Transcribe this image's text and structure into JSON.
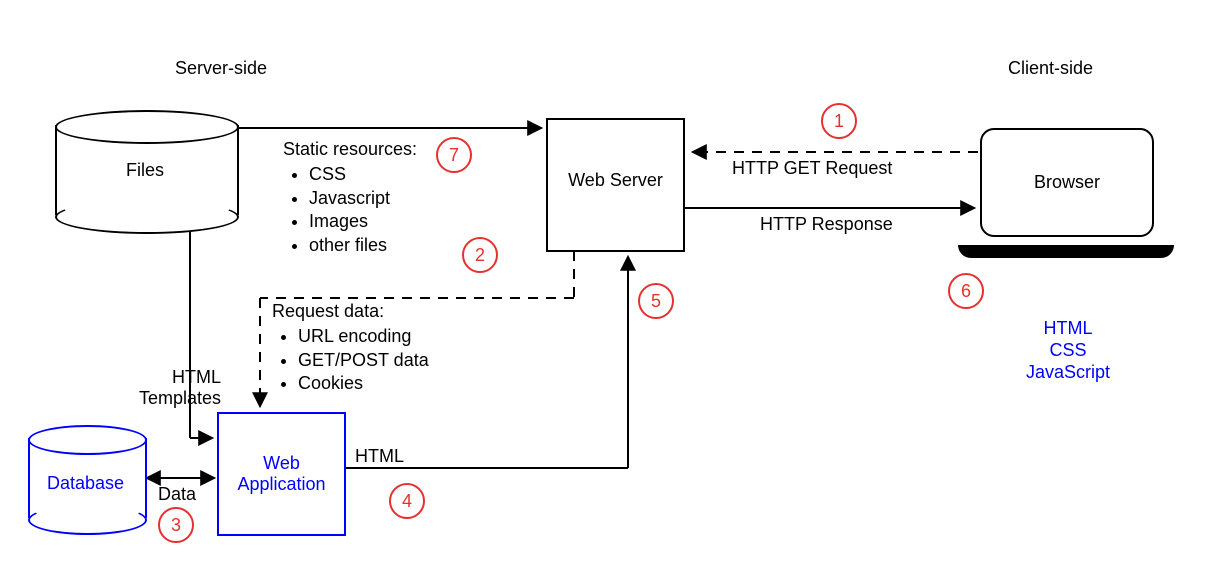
{
  "headers": {
    "server_side": "Server-side",
    "client_side": "Client-side"
  },
  "files": {
    "label": "Files"
  },
  "database": {
    "label": "Database"
  },
  "web_server": {
    "label": "Web Server"
  },
  "web_app": {
    "label": "Web\nApplication"
  },
  "browser": {
    "label": "Browser"
  },
  "static_resources": {
    "title": "Static resources:",
    "items": [
      "CSS",
      "Javascript",
      "Images",
      "other files"
    ]
  },
  "request_data": {
    "title": "Request data:",
    "items": [
      "URL encoding",
      "GET/POST data",
      "Cookies"
    ]
  },
  "edges": {
    "http_get": "HTTP GET Request",
    "http_response": "HTTP Response",
    "html_templates": "HTML\nTemplates",
    "data": "Data",
    "html": "HTML"
  },
  "client_outputs": {
    "html": "HTML",
    "css": "CSS",
    "js": "JavaScript"
  },
  "steps": {
    "1": "1",
    "2": "2",
    "3": "3",
    "4": "4",
    "5": "5",
    "6": "6",
    "7": "7"
  }
}
